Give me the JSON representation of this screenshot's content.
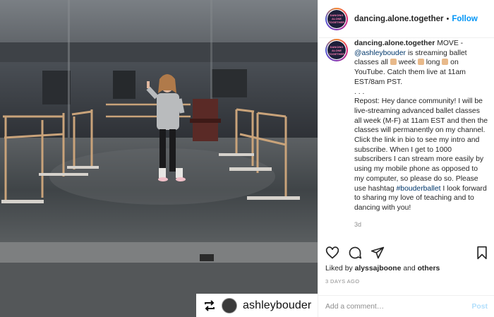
{
  "header": {
    "username": "dancing.alone.together",
    "separator": "•",
    "follow_label": "Follow"
  },
  "avatar_logo": [
    "DANCING",
    "ALONE",
    "TOGETHER"
  ],
  "caption": {
    "username": "dancing.alone.together",
    "intro": " MOVE - ",
    "mention": "@ashleybouder",
    "line_a": " is streaming ballet classes all ",
    "word_week": " week ",
    "word_long": " long ",
    "line_b": " on YouTube. Catch them live at 11am EST/8am PST.",
    "ellipsis": ". . .",
    "repost_text": "Repost: Hey dance community! I will be live-streaming advanced ballet classes all week (M-F) at 11am EST and then the classes will permanently on my channel. Click the link in bio to see my intro and subscribe. When I get to 1000 subscribers I can stream more easily by using my mobile phone as opposed to my computer, so please do so. Please use hashtag ",
    "hashtag": "#bouderballet",
    "repost_tail": " I look forward to sharing my love of teaching and to dancing with you!",
    "time": "3d"
  },
  "likes": {
    "prefix": "Liked by ",
    "user": "alyssajboone",
    "and": " and ",
    "others": "others"
  },
  "date": "3 DAYS AGO",
  "comment": {
    "placeholder": "Add a comment…",
    "post_label": "Post"
  },
  "repost_tag": {
    "username": "ashleybouder"
  },
  "icons": {
    "like": "heart-icon",
    "comment": "comment-icon",
    "share": "share-icon",
    "save": "bookmark-icon",
    "repost": "repost-icon"
  },
  "colors": {
    "link": "#00376b",
    "follow": "#0095f6",
    "post_disabled": "#b2dffc",
    "muted": "#8e8e8e"
  }
}
